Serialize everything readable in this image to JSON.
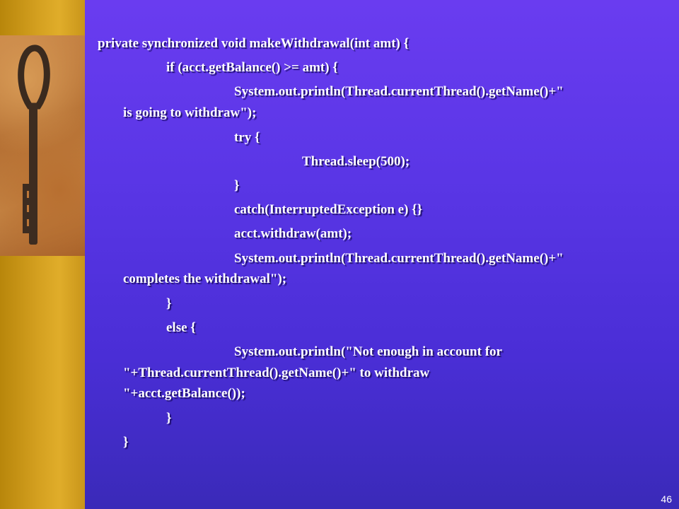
{
  "code_lines": [
    "private synchronized void makeWithdrawal(int amt) {",
    "if (acct.getBalance() >= amt) {",
    "System.out.println(Thread.currentThread().getName()+\"",
    "is going to withdraw\");",
    "try {",
    "Thread.sleep(500);",
    "}",
    "catch(InterruptedException e) {}",
    "acct.withdraw(amt);",
    "System.out.println(Thread.currentThread().getName()+\"",
    "completes the withdrawal\");",
    "}",
    "else {",
    "System.out.println(\"Not enough in account for",
    "\"+Thread.currentThread().getName()+\" to withdraw",
    "\"+acct.getBalance());",
    "}",
    "}"
  ],
  "page_number": "46",
  "colors": {
    "slide_bg": "#5a36e6",
    "sidebar": "#d4a020",
    "text": "#ffffff"
  },
  "icons": [
    "key-image"
  ]
}
